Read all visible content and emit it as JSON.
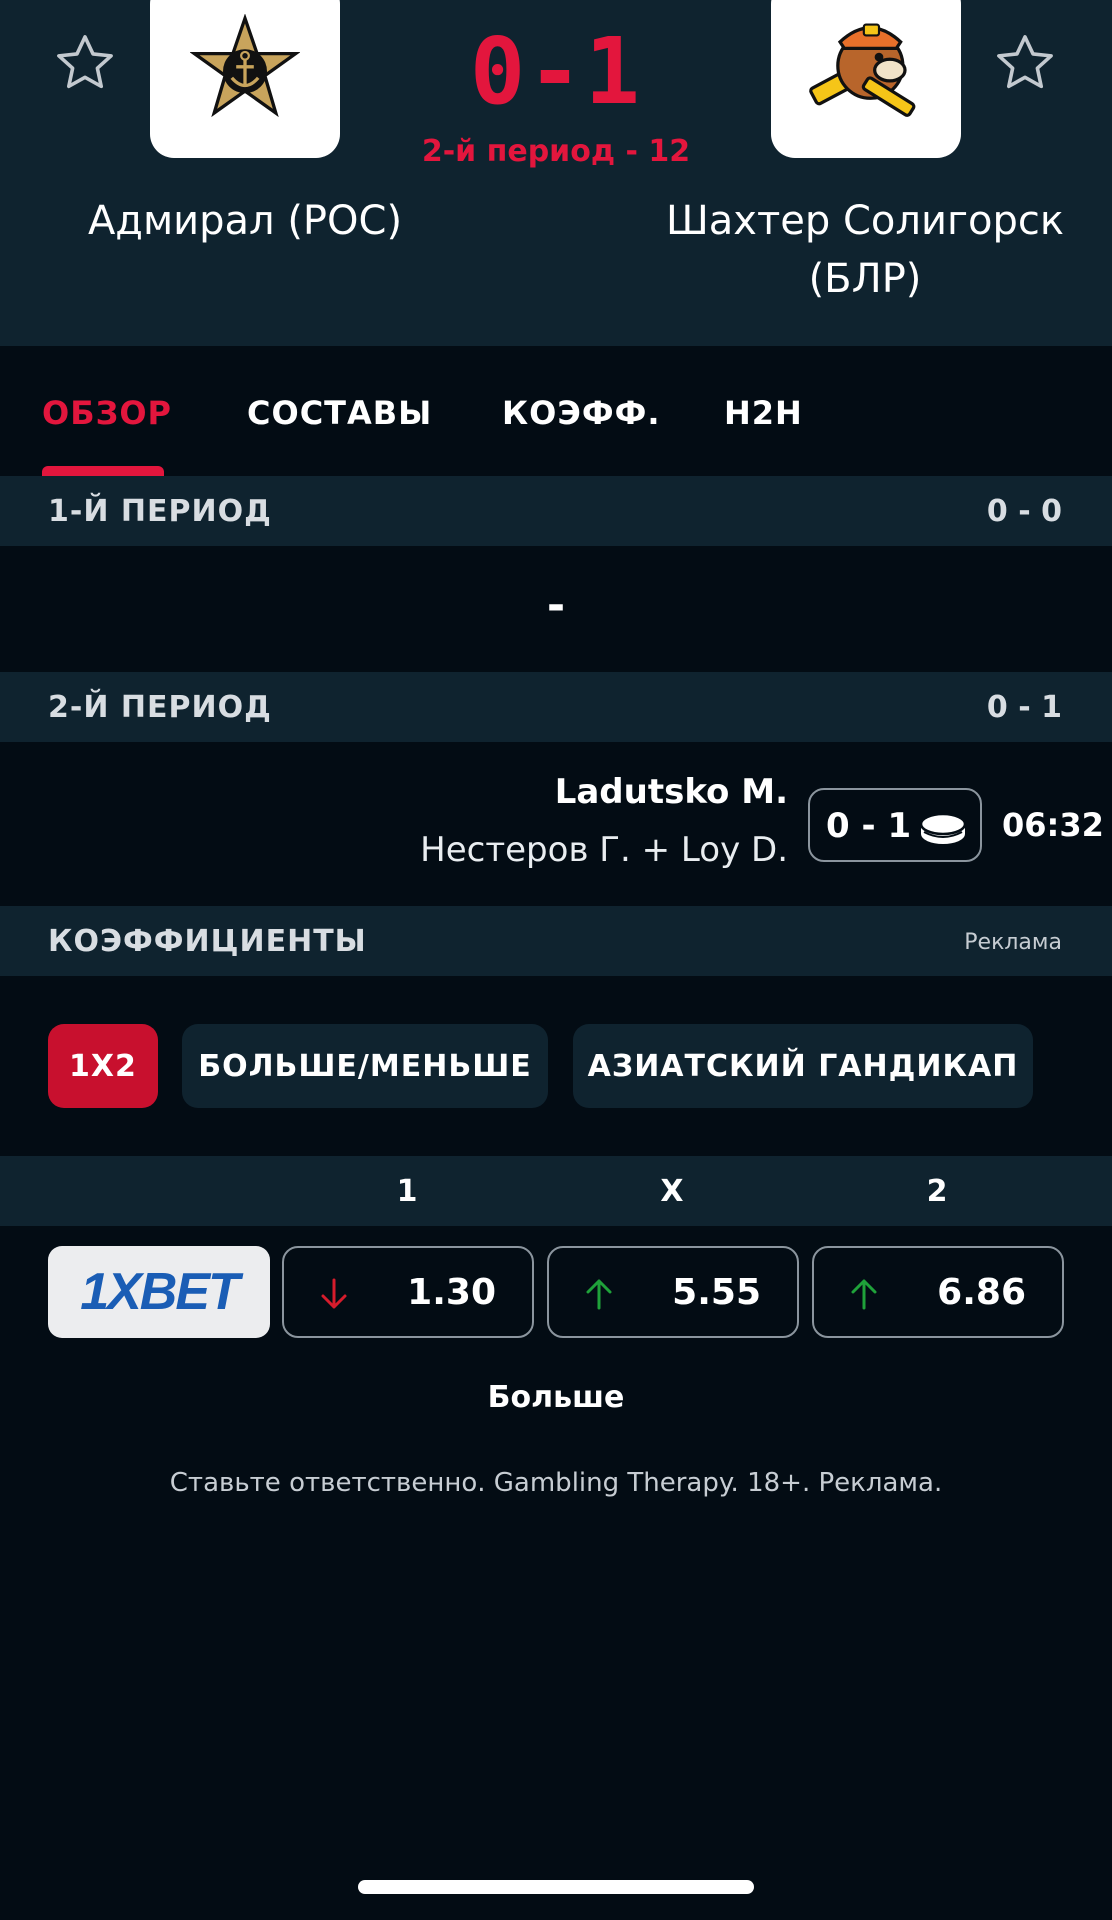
{
  "match": {
    "score": "0-1",
    "status": "2-й период - 12",
    "home_team": "Адмирал (РОС)",
    "away_team": "Шахтер Солигорск (БЛР)"
  },
  "tabs": [
    "ОБЗОР",
    "СОСТАВЫ",
    "КОЭФФ.",
    "H2H"
  ],
  "periods": [
    {
      "title": "1-Й ПЕРИОД",
      "score": "0 - 0",
      "empty_text": "-"
    },
    {
      "title": "2-Й ПЕРИОД",
      "score": "0 - 1"
    }
  ],
  "goal": {
    "scorer": "Ladutsko M.",
    "assist": "Нестеров Г.  +  Loy D.",
    "score": "0 - 1",
    "time": "06:32"
  },
  "odds_section": {
    "title": "КОЭФФИЦИЕНТЫ",
    "ad_label": "Реклама",
    "chips": [
      "1X2",
      "БОЛЬШЕ/МЕНЬШЕ",
      "АЗИАТСКИЙ ГАНДИКАП"
    ],
    "columns": [
      "1",
      "X",
      "2"
    ],
    "bookmaker": "1XBET",
    "odds": [
      {
        "value": "1.30",
        "direction": "down"
      },
      {
        "value": "5.55",
        "direction": "up"
      },
      {
        "value": "6.86",
        "direction": "up"
      }
    ],
    "more_label": "Больше",
    "disclaimer": "Ставьте ответственно. Gambling Therapy. 18+. Реклама."
  },
  "colors": {
    "accent": "#e3163d",
    "panel": "#0f232f",
    "background": "#030c14",
    "odds_down": "#d61c2c",
    "odds_up": "#1fa23a"
  }
}
